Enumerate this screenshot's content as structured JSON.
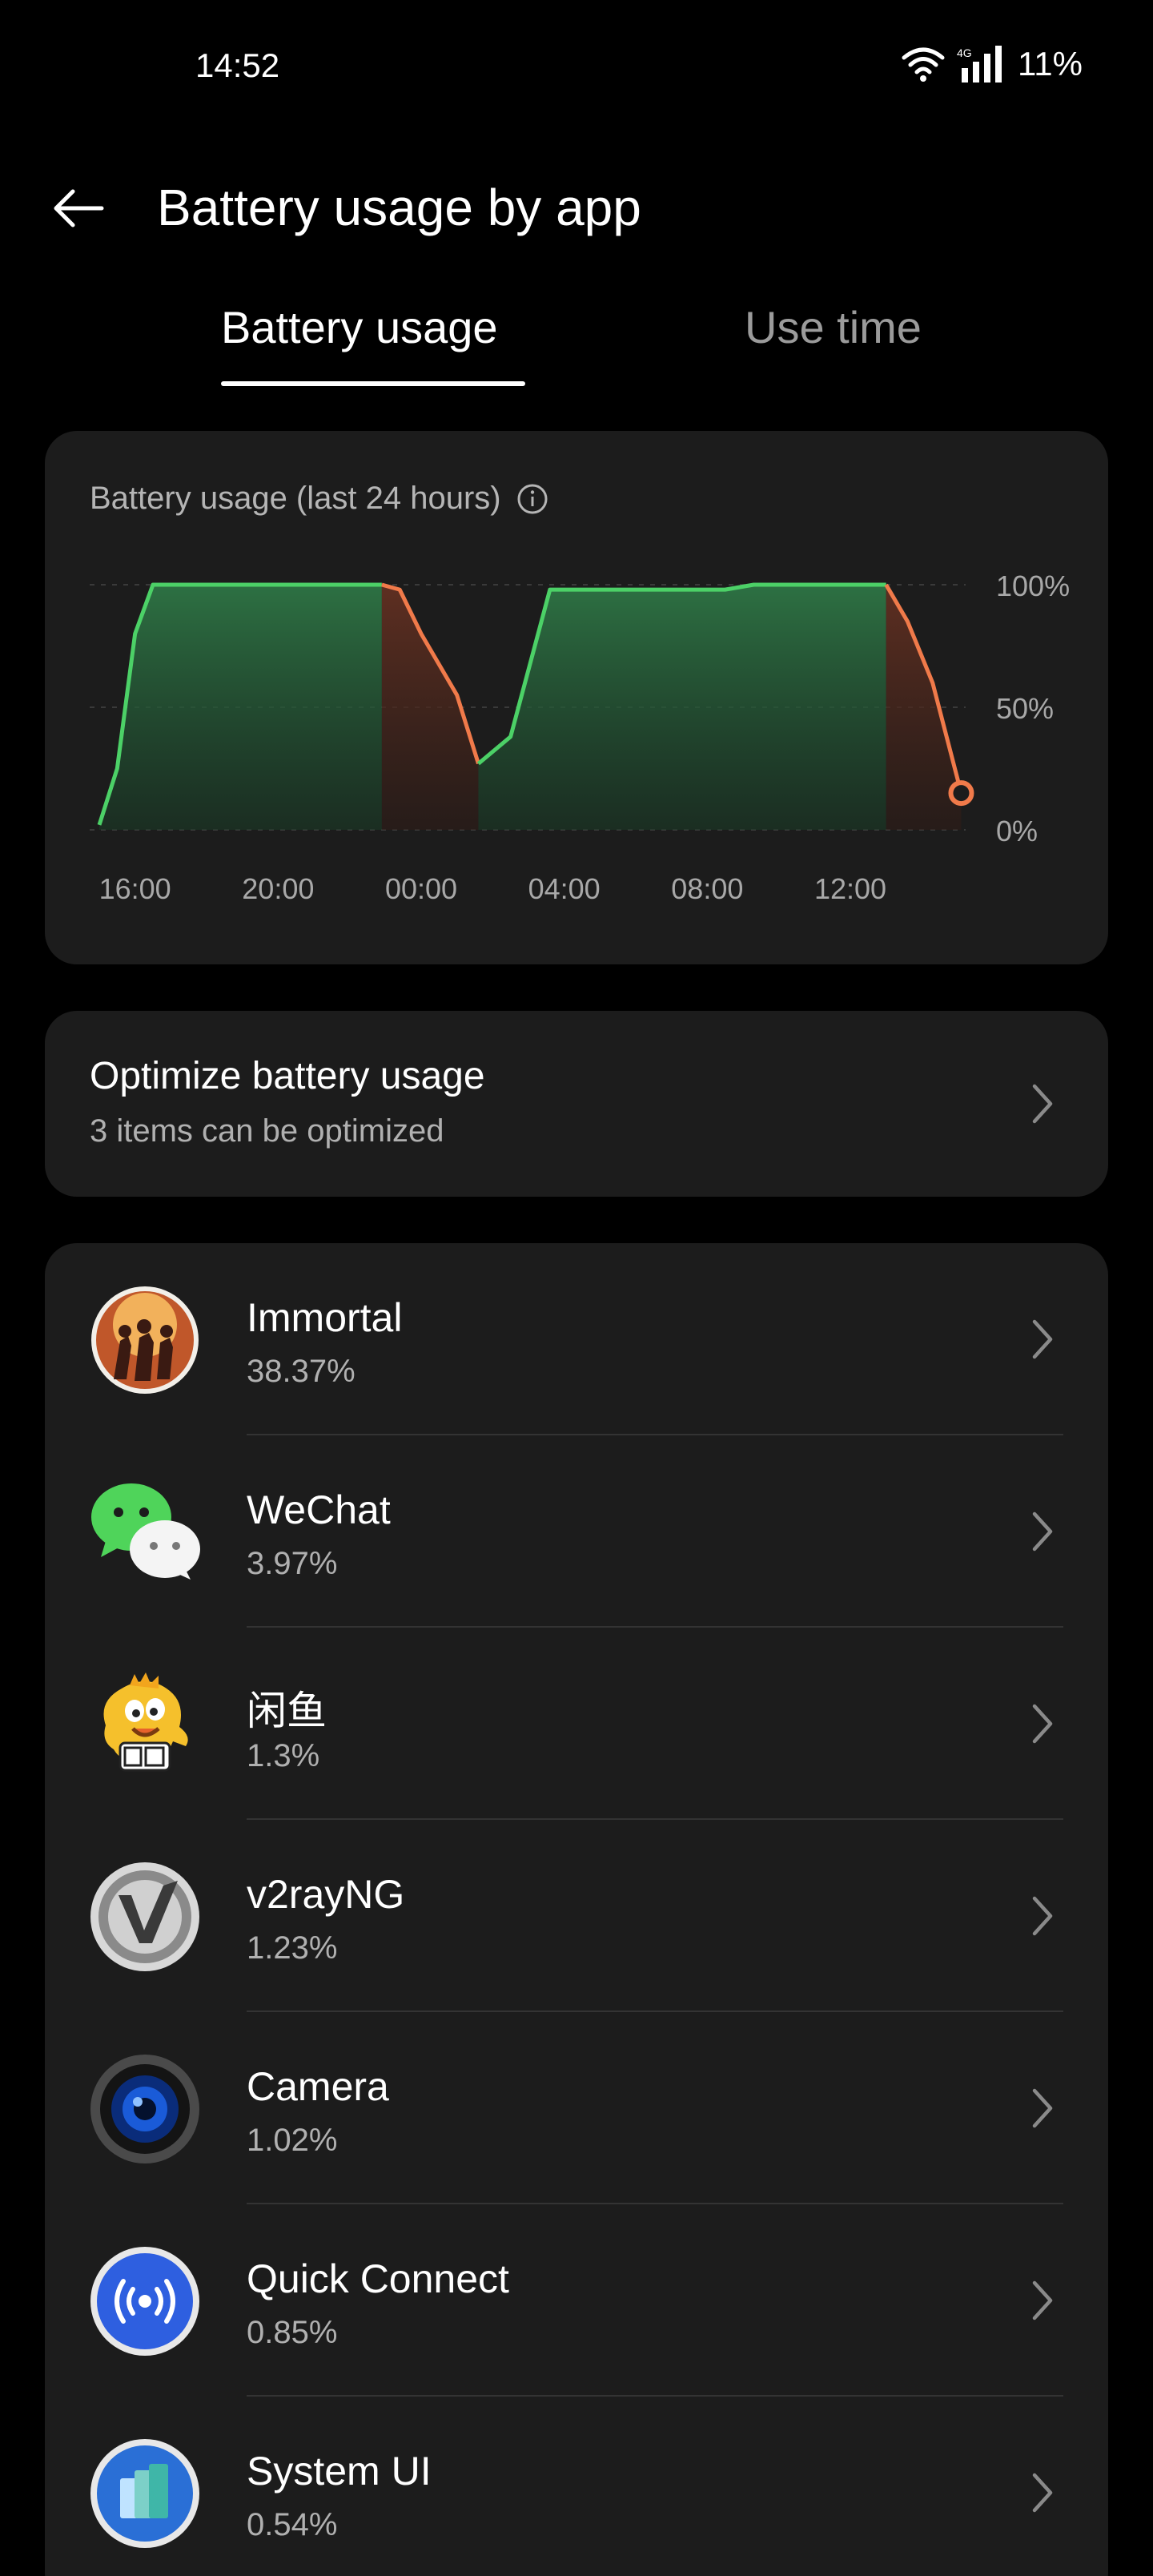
{
  "status": {
    "time": "14:52",
    "network": "4G",
    "battery": "11%"
  },
  "header": {
    "title": "Battery usage by app"
  },
  "tabs": [
    {
      "label": "Battery usage"
    },
    {
      "label": "Use time"
    }
  ],
  "chart_data": {
    "type": "area",
    "title": "Battery usage (last 24 hours)",
    "x_tick_labels": [
      "16:00",
      "20:00",
      "00:00",
      "04:00",
      "08:00",
      "12:00"
    ],
    "y_tick_labels": [
      "100%",
      "50%",
      "0%"
    ],
    "ylim": [
      0,
      100
    ],
    "xlim_hours": [
      0,
      24
    ],
    "series": [
      {
        "x": [
          0,
          0.5,
          1,
          1.5,
          2,
          7.9,
          8.4,
          9,
          10,
          10.6,
          11.5,
          12.6,
          13,
          17.5,
          18.3,
          22,
          22.6,
          23.3,
          24.1
        ],
        "y": [
          2,
          25,
          80,
          100,
          100,
          100,
          98,
          80,
          55,
          27,
          38,
          98,
          98,
          98,
          100,
          100,
          85,
          60,
          15
        ]
      }
    ],
    "colors": {
      "charging": "#4cd167",
      "discharging": "#f07a4a"
    }
  },
  "optimize": {
    "title": "Optimize battery usage",
    "subtitle": "3 items can be optimized"
  },
  "apps": [
    {
      "name": "Immortal",
      "usage": "38.37%",
      "icon": "immortal-game-icon"
    },
    {
      "name": "WeChat",
      "usage": "3.97%",
      "icon": "wechat-icon"
    },
    {
      "name": "闲鱼",
      "usage": "1.3%",
      "icon": "xianyu-icon"
    },
    {
      "name": "v2rayNG",
      "usage": "1.23%",
      "icon": "v2rayng-icon"
    },
    {
      "name": "Camera",
      "usage": "1.02%",
      "icon": "camera-icon"
    },
    {
      "name": "Quick Connect",
      "usage": "0.85%",
      "icon": "quick-connect-icon"
    },
    {
      "name": "System UI",
      "usage": "0.54%",
      "icon": "system-ui-icon"
    }
  ]
}
